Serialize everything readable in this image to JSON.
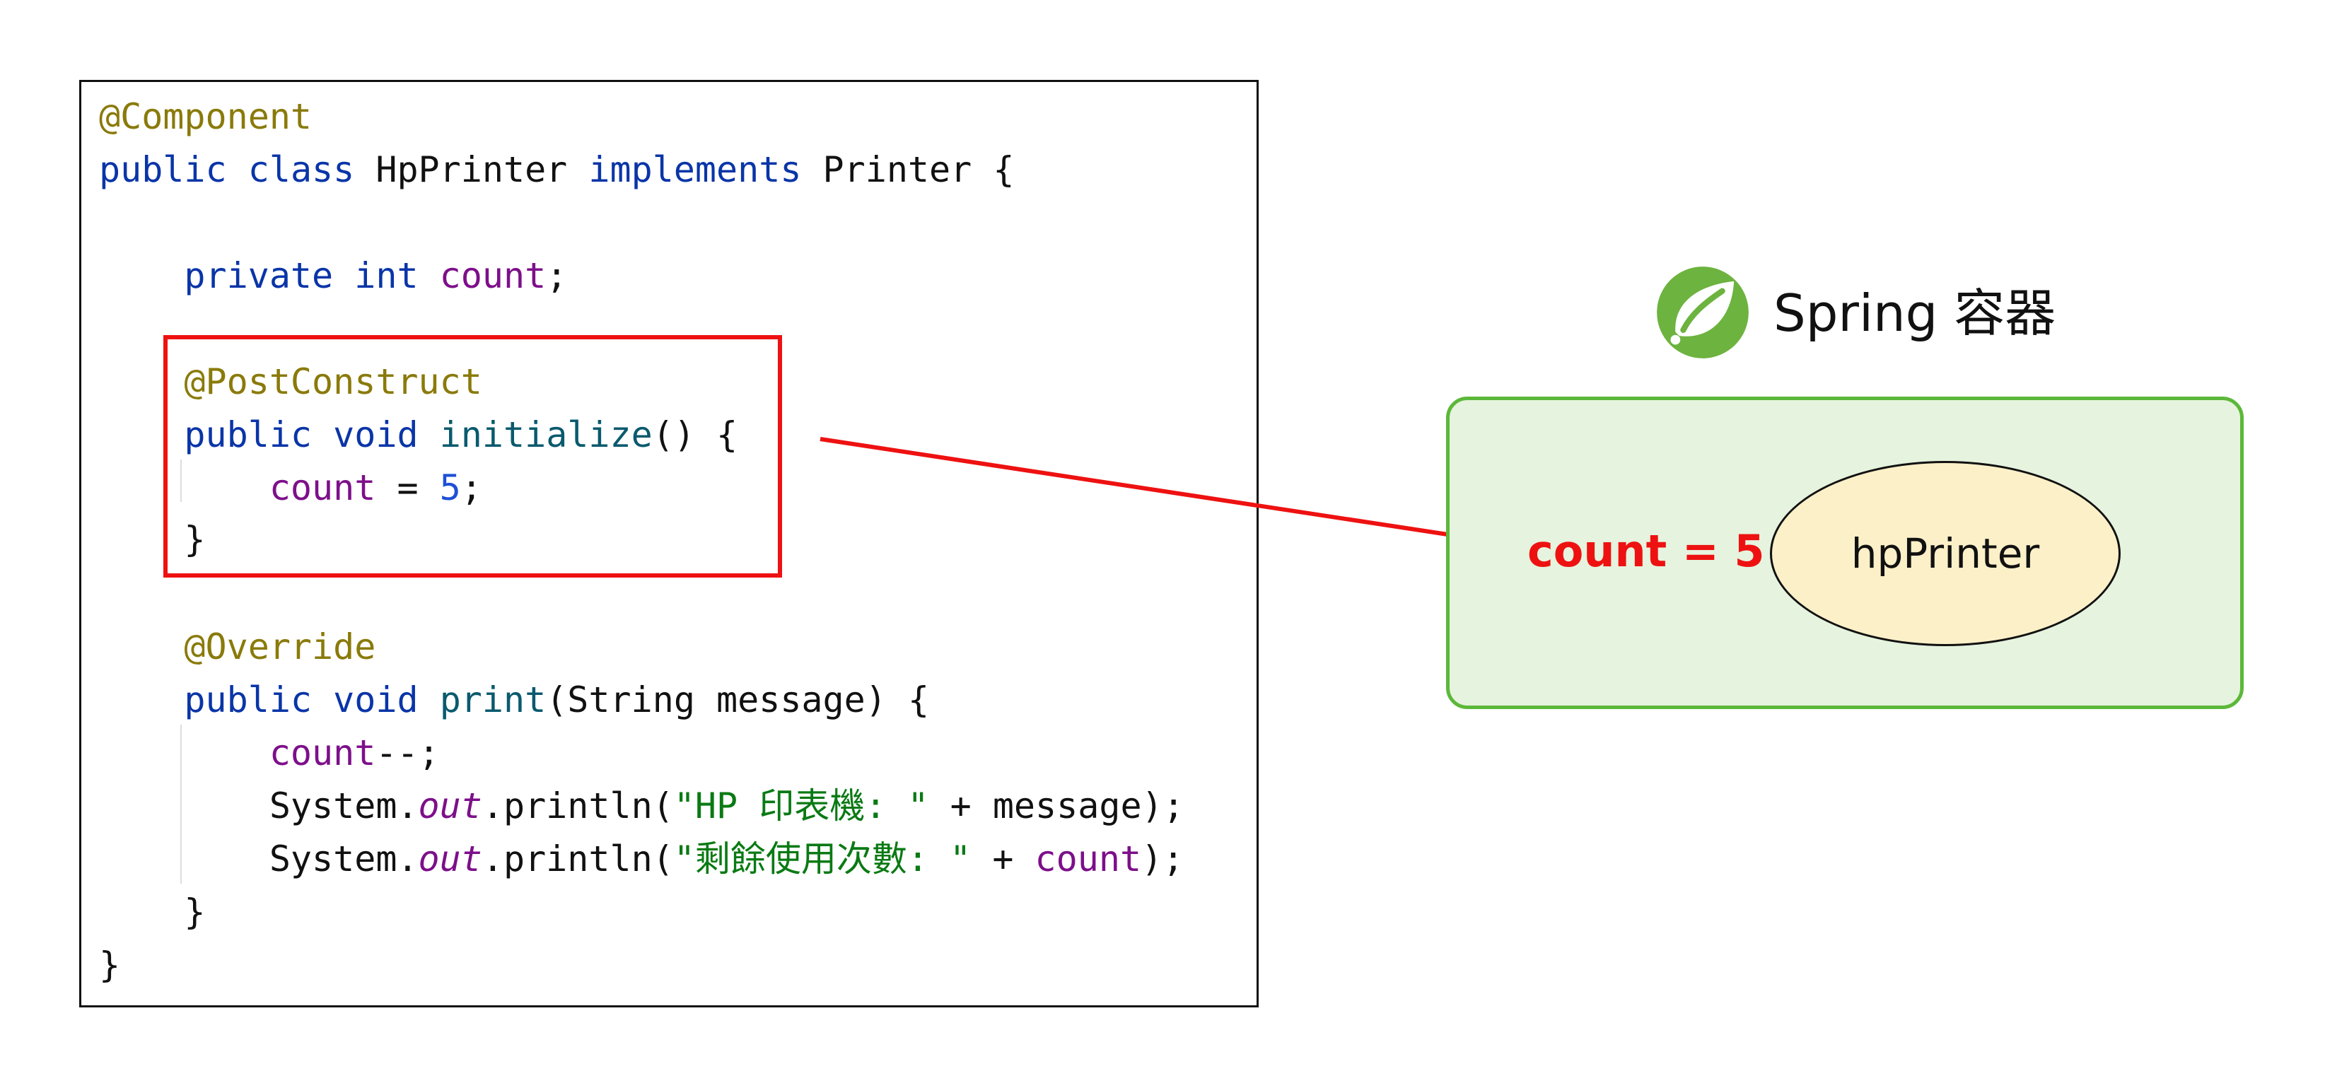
{
  "code": {
    "lines": [
      [
        {
          "t": "@Component",
          "c": "ann"
        }
      ],
      [
        {
          "t": "public",
          "c": "kw"
        },
        {
          "t": " ",
          "c": "pln"
        },
        {
          "t": "class",
          "c": "kw"
        },
        {
          "t": " HpPrinter ",
          "c": "pln"
        },
        {
          "t": "implements",
          "c": "kw"
        },
        {
          "t": " Printer {",
          "c": "pln"
        }
      ],
      [],
      [
        {
          "t": "    ",
          "c": "pln"
        },
        {
          "t": "private",
          "c": "kw"
        },
        {
          "t": " ",
          "c": "pln"
        },
        {
          "t": "int",
          "c": "kw"
        },
        {
          "t": " ",
          "c": "pln"
        },
        {
          "t": "count",
          "c": "fld"
        },
        {
          "t": ";",
          "c": "pln"
        }
      ],
      [],
      [
        {
          "t": "    ",
          "c": "pln"
        },
        {
          "t": "@PostConstruct",
          "c": "ann"
        }
      ],
      [
        {
          "t": "    ",
          "c": "pln"
        },
        {
          "t": "public",
          "c": "kw"
        },
        {
          "t": " ",
          "c": "pln"
        },
        {
          "t": "void",
          "c": "kw"
        },
        {
          "t": " ",
          "c": "pln"
        },
        {
          "t": "initialize",
          "c": "mth"
        },
        {
          "t": "() {",
          "c": "pln"
        }
      ],
      [
        {
          "t": "        ",
          "c": "pln"
        },
        {
          "t": "count",
          "c": "fld"
        },
        {
          "t": " = ",
          "c": "pln"
        },
        {
          "t": "5",
          "c": "num"
        },
        {
          "t": ";",
          "c": "pln"
        }
      ],
      [
        {
          "t": "    }",
          "c": "pln"
        }
      ],
      [],
      [
        {
          "t": "    ",
          "c": "pln"
        },
        {
          "t": "@Override",
          "c": "ann"
        }
      ],
      [
        {
          "t": "    ",
          "c": "pln"
        },
        {
          "t": "public",
          "c": "kw"
        },
        {
          "t": " ",
          "c": "pln"
        },
        {
          "t": "void",
          "c": "kw"
        },
        {
          "t": " ",
          "c": "pln"
        },
        {
          "t": "print",
          "c": "mth"
        },
        {
          "t": "(String message) {",
          "c": "pln"
        }
      ],
      [
        {
          "t": "        ",
          "c": "pln"
        },
        {
          "t": "count",
          "c": "fld"
        },
        {
          "t": "--;",
          "c": "pln"
        }
      ],
      [
        {
          "t": "        System.",
          "c": "pln"
        },
        {
          "t": "out",
          "c": "sfld"
        },
        {
          "t": ".println(",
          "c": "pln"
        },
        {
          "t": "\"HP 印表機: \"",
          "c": "str"
        },
        {
          "t": " + message);",
          "c": "pln"
        }
      ],
      [
        {
          "t": "        System.",
          "c": "pln"
        },
        {
          "t": "out",
          "c": "sfld"
        },
        {
          "t": ".println(",
          "c": "pln"
        },
        {
          "t": "\"剩餘使用次數: \"",
          "c": "str"
        },
        {
          "t": " + ",
          "c": "pln"
        },
        {
          "t": "count",
          "c": "fld"
        },
        {
          "t": ");",
          "c": "pln"
        }
      ],
      [
        {
          "t": "    }",
          "c": "pln"
        }
      ],
      [
        {
          "t": "}",
          "c": "pln"
        }
      ]
    ]
  },
  "spring": {
    "logo_icon": "spring-leaf-icon",
    "title": "Spring 容器"
  },
  "container": {
    "count_label": "count = 5",
    "bean_name": "hpPrinter"
  },
  "colors": {
    "highlight": "#ee1111",
    "container_border": "#5cb83a",
    "container_fill": "#e6f3de",
    "bean_fill": "#fcf0c8",
    "spring_green": "#6db33f"
  }
}
